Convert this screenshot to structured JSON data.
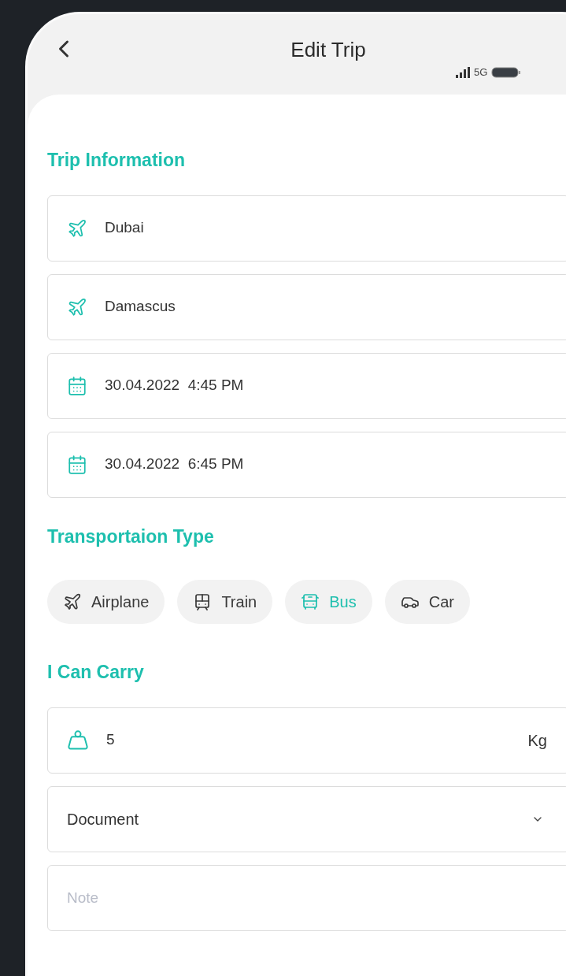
{
  "header": {
    "title": "Edit Trip",
    "network": "5G"
  },
  "trip_information": {
    "title": "Trip Information",
    "fields": [
      {
        "kind": "place",
        "value": "Dubai"
      },
      {
        "kind": "place",
        "value": "Damascus"
      },
      {
        "kind": "datetime",
        "value": "30.04.2022  4:45 PM"
      },
      {
        "kind": "datetime",
        "value": "30.04.2022  6:45 PM"
      }
    ]
  },
  "transportation_type": {
    "title": "Transportaion Type",
    "options": [
      {
        "kind": "airplane",
        "label": "Airplane",
        "selected": false
      },
      {
        "kind": "train",
        "label": "Train",
        "selected": false
      },
      {
        "kind": "bus",
        "label": "Bus",
        "selected": true
      },
      {
        "kind": "car",
        "label": "Car",
        "selected": false
      }
    ]
  },
  "carry": {
    "title": "I Can Carry",
    "weight": {
      "value": "5",
      "unit": "Kg"
    },
    "category": {
      "value": "Document"
    },
    "note": {
      "placeholder": "Note"
    }
  }
}
